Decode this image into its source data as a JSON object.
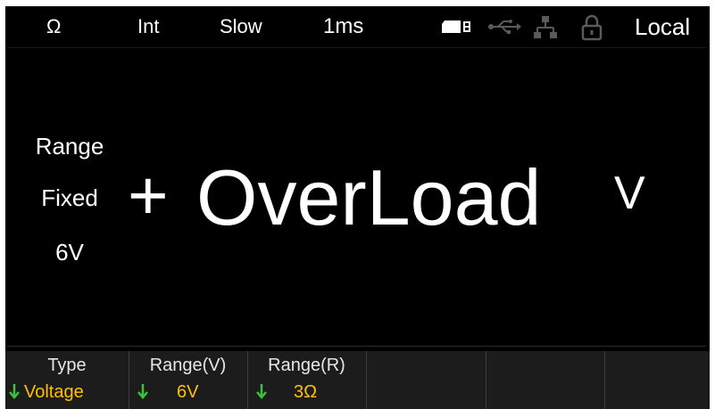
{
  "status": {
    "mode": "Ω",
    "trigger": "Int",
    "speed": "Slow",
    "aperture": "1ms",
    "remote": "Local",
    "icons": [
      "memory-card-icon",
      "usb-icon",
      "lan-icon",
      "lock-icon"
    ]
  },
  "display": {
    "range_label": "Range",
    "range_mode": "Fixed",
    "range_value": "6V",
    "sign": "+",
    "reading": "OverLoad",
    "unit": "V"
  },
  "menu": {
    "keys": [
      {
        "title": "Type",
        "value": "Voltage"
      },
      {
        "title": "Range(V)",
        "value": "6V"
      },
      {
        "title": "Range(R)",
        "value": "3Ω"
      }
    ]
  },
  "colors": {
    "background": "#000000",
    "text": "#ffffff",
    "menu_value": "#ffc000",
    "arrow": "#3cc23c",
    "menu_bg": "#1c1c1c"
  }
}
